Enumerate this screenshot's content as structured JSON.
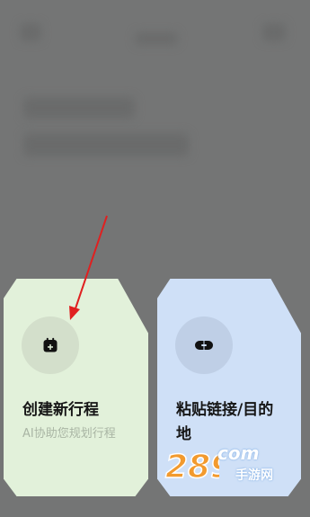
{
  "cards": [
    {
      "title": "创建新行程",
      "subtitle": "AI协助您规划行程",
      "icon": "calendar-plus-icon",
      "background": "#e2f1da"
    },
    {
      "title": "粘贴链接/目的地",
      "icon": "link-icon",
      "background": "#cfe0f7"
    }
  ],
  "watermark": {
    "logo": "289",
    "domain": "com",
    "text": "手游网"
  },
  "colors": {
    "overlay": "#747575",
    "annotation": "#e02020"
  }
}
